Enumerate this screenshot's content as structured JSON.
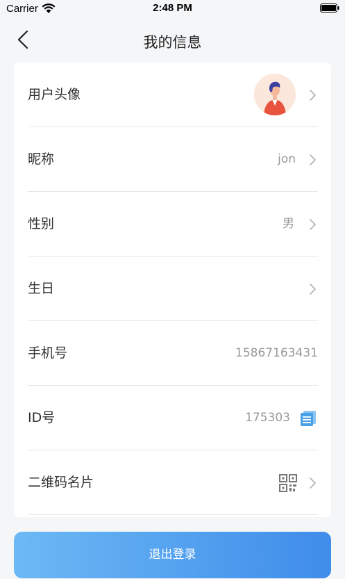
{
  "status_bar": {
    "carrier": "Carrier",
    "time": "2:48 PM"
  },
  "nav": {
    "title": "我的信息",
    "back_icon": "chevron-left-icon"
  },
  "rows": [
    {
      "label": "用户头像",
      "value": "",
      "trailing": "chevron-right-icon"
    },
    {
      "label": "昵称",
      "value": "jon",
      "trailing": "chevron-right-icon"
    },
    {
      "label": "性别",
      "value": "男",
      "trailing": "chevron-right-icon"
    },
    {
      "label": "生日",
      "value": "",
      "trailing": "chevron-right-icon"
    },
    {
      "label": "手机号",
      "value": "15867163431",
      "trailing": ""
    },
    {
      "label": "ID号",
      "value": "175303",
      "trailing": "copy-icon"
    },
    {
      "label": "二维码名片",
      "value": "",
      "trailing": "chevron-right-icon"
    }
  ],
  "logout_label": "退出登录",
  "colors": {
    "accent_start": "#6cb9f5",
    "accent_end": "#3f8cea",
    "copy_icon": "#4aa0e6"
  }
}
